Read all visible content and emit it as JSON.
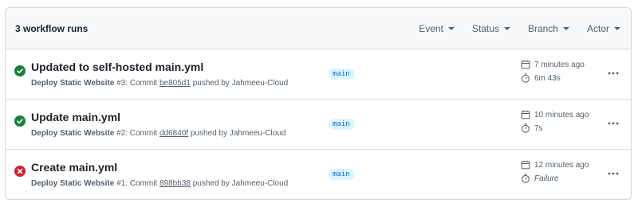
{
  "header": {
    "count_label": "3 workflow runs",
    "filters": [
      {
        "label": "Event"
      },
      {
        "label": "Status"
      },
      {
        "label": "Branch"
      },
      {
        "label": "Actor"
      }
    ]
  },
  "runs": [
    {
      "status": "success",
      "title": "Updated to self-hosted main.yml",
      "workflow": "Deploy Static Website",
      "run_number": "#3",
      "commit_prefix": ": Commit ",
      "commit_sha": "be805d1",
      "actor_text": " pushed by Jahmeeu-Cloud",
      "branch": "main",
      "time_ago": "7 minutes ago",
      "duration": "6m 43s"
    },
    {
      "status": "success",
      "title": "Update main.yml",
      "workflow": "Deploy Static Website",
      "run_number": "#2",
      "commit_prefix": ": Commit ",
      "commit_sha": "dd6840f",
      "actor_text": " pushed by Jahmeeu-Cloud",
      "branch": "main",
      "time_ago": "10 minutes ago",
      "duration": "7s"
    },
    {
      "status": "failure",
      "title": "Create main.yml",
      "workflow": "Deploy Static Website",
      "run_number": "#1",
      "commit_prefix": ": Commit ",
      "commit_sha": "898bb38",
      "actor_text": " pushed by Jahmeeu-Cloud",
      "branch": "main",
      "time_ago": "12 minutes ago",
      "duration": "Failure"
    }
  ],
  "colors": {
    "success": "#1a7f37",
    "failure": "#cf222e",
    "branch_bg": "#ddf4ff",
    "branch_fg": "#0969da"
  }
}
